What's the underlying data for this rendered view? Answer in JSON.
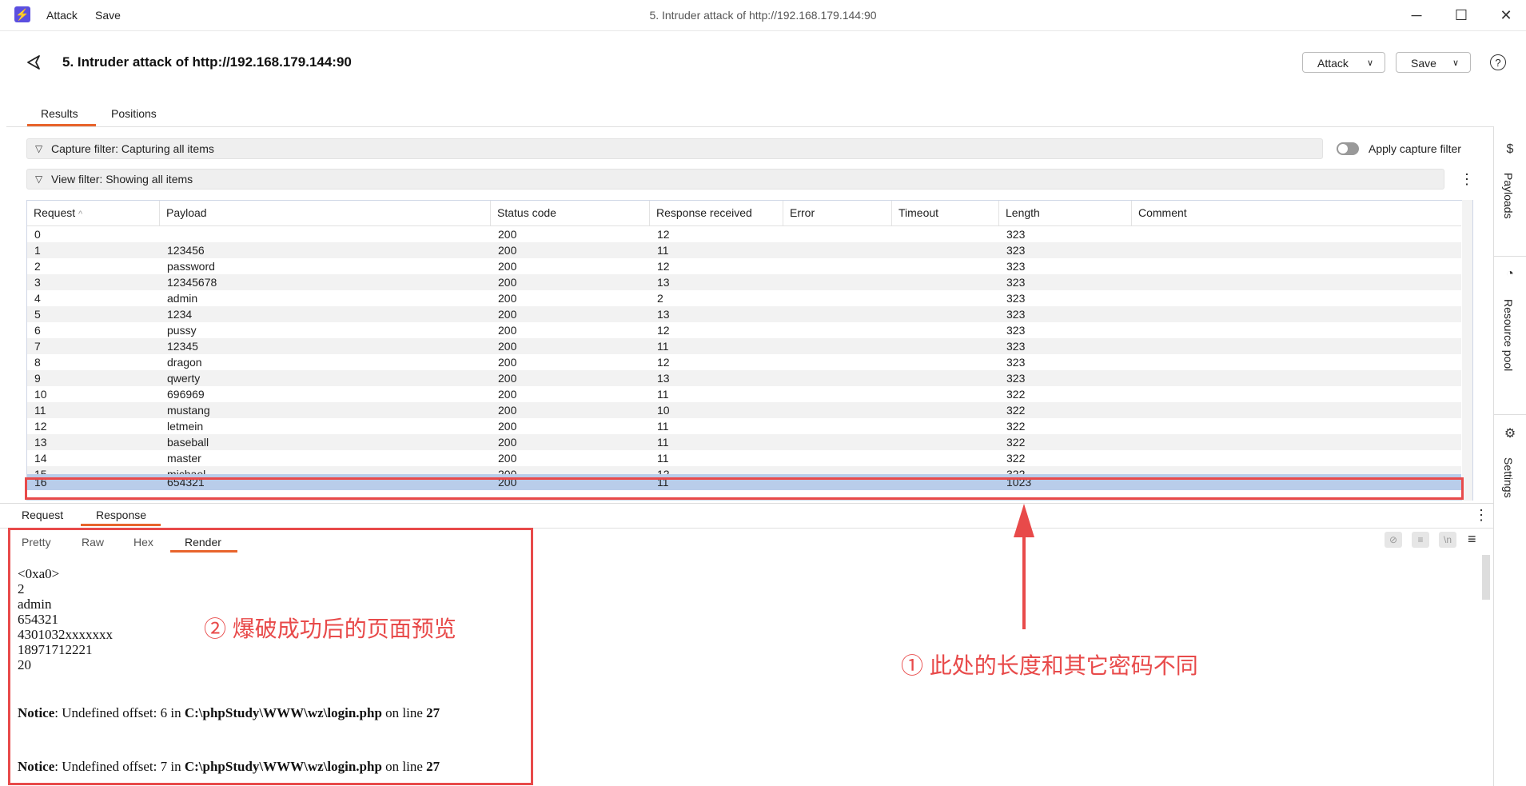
{
  "titlebar": {
    "menu": [
      "Attack",
      "Save"
    ],
    "window_title": "5. Intruder attack of http://192.168.179.144:90"
  },
  "header": {
    "title": "5. Intruder attack of http://192.168.179.144:90",
    "attack_button": "Attack",
    "save_button": "Save",
    "help": "?"
  },
  "tabs": [
    "Results",
    "Positions"
  ],
  "filters": {
    "capture": "Capture filter: Capturing all items",
    "apply_capture": "Apply capture filter",
    "view": "View filter: Showing all items"
  },
  "sidebar": [
    "Payloads",
    "Resource pool",
    "Settings"
  ],
  "table": {
    "columns": [
      "Request",
      "Payload",
      "Status code",
      "Response received",
      "Error",
      "Timeout",
      "Length",
      "Comment"
    ],
    "sort_indicator": "^",
    "rows": [
      [
        "0",
        "",
        "200",
        "12",
        "",
        "",
        "323",
        ""
      ],
      [
        "1",
        "123456",
        "200",
        "11",
        "",
        "",
        "323",
        ""
      ],
      [
        "2",
        "password",
        "200",
        "12",
        "",
        "",
        "323",
        ""
      ],
      [
        "3",
        "12345678",
        "200",
        "13",
        "",
        "",
        "323",
        ""
      ],
      [
        "4",
        "admin",
        "200",
        "2",
        "",
        "",
        "323",
        ""
      ],
      [
        "5",
        "1234",
        "200",
        "13",
        "",
        "",
        "323",
        ""
      ],
      [
        "6",
        "pussy",
        "200",
        "12",
        "",
        "",
        "323",
        ""
      ],
      [
        "7",
        "12345",
        "200",
        "11",
        "",
        "",
        "323",
        ""
      ],
      [
        "8",
        "dragon",
        "200",
        "12",
        "",
        "",
        "323",
        ""
      ],
      [
        "9",
        "qwerty",
        "200",
        "13",
        "",
        "",
        "323",
        ""
      ],
      [
        "10",
        "696969",
        "200",
        "11",
        "",
        "",
        "322",
        ""
      ],
      [
        "11",
        "mustang",
        "200",
        "10",
        "",
        "",
        "322",
        ""
      ],
      [
        "12",
        "letmein",
        "200",
        "11",
        "",
        "",
        "322",
        ""
      ],
      [
        "13",
        "baseball",
        "200",
        "11",
        "",
        "",
        "322",
        ""
      ],
      [
        "14",
        "master",
        "200",
        "11",
        "",
        "",
        "322",
        ""
      ],
      [
        "15",
        "michael",
        "200",
        "12",
        "",
        "",
        "322",
        ""
      ],
      [
        "16",
        "654321",
        "200",
        "11",
        "",
        "",
        "1023",
        ""
      ]
    ]
  },
  "reqresp_tabs": [
    "Request",
    "Response"
  ],
  "view_tabs": [
    "Pretty",
    "Raw",
    "Hex",
    "Render"
  ],
  "render": {
    "lines": [
      "<0xa0>",
      "2",
      "admin",
      "654321",
      "4301032xxxxxxx",
      "18971712221",
      "20"
    ],
    "notice1": {
      "label": "Notice",
      "text": ": Undefined offset: 6 in ",
      "path": "C:\\phpStudy\\WWW\\wz\\login.php",
      "mid": " on line ",
      "line": "27"
    },
    "notice2": {
      "label": "Notice",
      "text": ": Undefined offset: 7 in ",
      "path": "C:\\phpStudy\\WWW\\wz\\login.php",
      "mid": " on line ",
      "line": "27"
    }
  },
  "annotations": {
    "preview": "② 爆破成功后的页面预览",
    "length_note": "① 此处的长度和其它密码不同"
  },
  "colors": {
    "accent": "#e8642c",
    "highlight": "#e84a4a",
    "selected_row": "#b9cdea",
    "logo": "#5b4fe0"
  }
}
